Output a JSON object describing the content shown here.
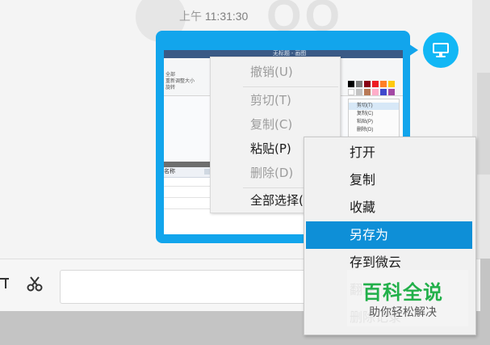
{
  "chat": {
    "timestamp_prefix": "上午",
    "timestamp_time": "11:31:30",
    "watermark": "QQ"
  },
  "thumbnail": {
    "window_title": "无标题 - 画图",
    "ribbon_options": [
      "全部",
      "重新调整大小",
      "旋转"
    ],
    "mini_menu": [
      "剪切(T)",
      "复制(C)",
      "粘贴(P)",
      "删除(D)"
    ],
    "table_head": "名称",
    "palette_colors": [
      "#000000",
      "#7f7f7f",
      "#880015",
      "#ed1c24",
      "#ff7f27",
      "#ffffff",
      "#c3c3c3",
      "#b97a57",
      "#ffaec9",
      "#ffc90e",
      "#3f48cc",
      "#a349a4"
    ]
  },
  "context_menu_image": {
    "items": [
      {
        "label": "撤销(U)",
        "disabled": true
      },
      {
        "label": "剪切(T)",
        "disabled": true
      },
      {
        "label": "复制(C)",
        "disabled": true
      },
      {
        "label": "粘贴(P)",
        "disabled": false
      },
      {
        "label": "删除(D)",
        "disabled": true
      },
      {
        "label": "全部选择(A)",
        "disabled": false
      }
    ]
  },
  "context_menu_file": {
    "items": [
      {
        "label": "打开",
        "active": false
      },
      {
        "label": "复制",
        "active": false
      },
      {
        "label": "收藏",
        "active": false
      },
      {
        "label": "另存为",
        "active": true
      },
      {
        "label": "存到微云",
        "active": false
      },
      {
        "label": "翻译",
        "active": false
      },
      {
        "label": "删除记录",
        "active": false
      }
    ]
  },
  "toolbar": {
    "icons": [
      "crop-icon",
      "scissors-icon"
    ]
  },
  "watermark": {
    "title": "百科全说",
    "subtitle": "助你轻松解决"
  },
  "colors": {
    "bubble": "#12a5ec",
    "avatar": "#12b7f5",
    "highlight": "#0e8fd7",
    "watermark_green": "#22b04a"
  }
}
